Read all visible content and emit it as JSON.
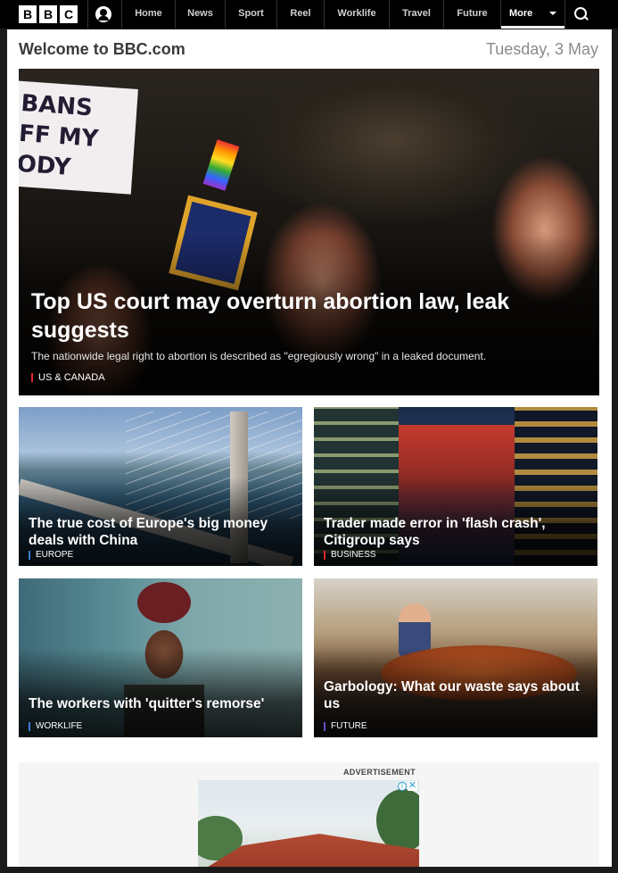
{
  "nav": {
    "logo_letters": [
      "B",
      "B",
      "C"
    ],
    "items": [
      "Home",
      "News",
      "Sport",
      "Reel",
      "Worklife",
      "Travel",
      "Future"
    ],
    "more_label": "More"
  },
  "header": {
    "welcome": "Welcome to BBC.com",
    "date": "Tuesday, 3 May"
  },
  "hero": {
    "sign_text": "BANS\nFF MY\nODY",
    "title": "Top US court may overturn abortion law, leak suggests",
    "summary": "The nationwide legal right to abortion is described as \"egregiously wrong\" in a leaked document.",
    "tag": "US & CANADA",
    "tag_color": "#e0262c"
  },
  "cards": [
    {
      "title": "The true cost of Europe's big money deals with China",
      "tag": "EUROPE",
      "tag_color": "#3a7bd5"
    },
    {
      "title": "Trader made error in 'flash crash', Citigroup says",
      "tag": "BUSINESS",
      "tag_color": "#e0262c"
    },
    {
      "title": "The workers with 'quitter's remorse'",
      "tag": "WORKLIFE",
      "tag_color": "#3a7bd5"
    },
    {
      "title": "Garbology: What our waste says about us",
      "tag": "FUTURE",
      "tag_color": "#6a4fc4"
    }
  ],
  "ad": {
    "label": "ADVERTISEMENT"
  },
  "colors": {
    "nav_bg": "#000000",
    "page_bg": "#ffffff",
    "outer_bg": "#1a1a1a"
  }
}
